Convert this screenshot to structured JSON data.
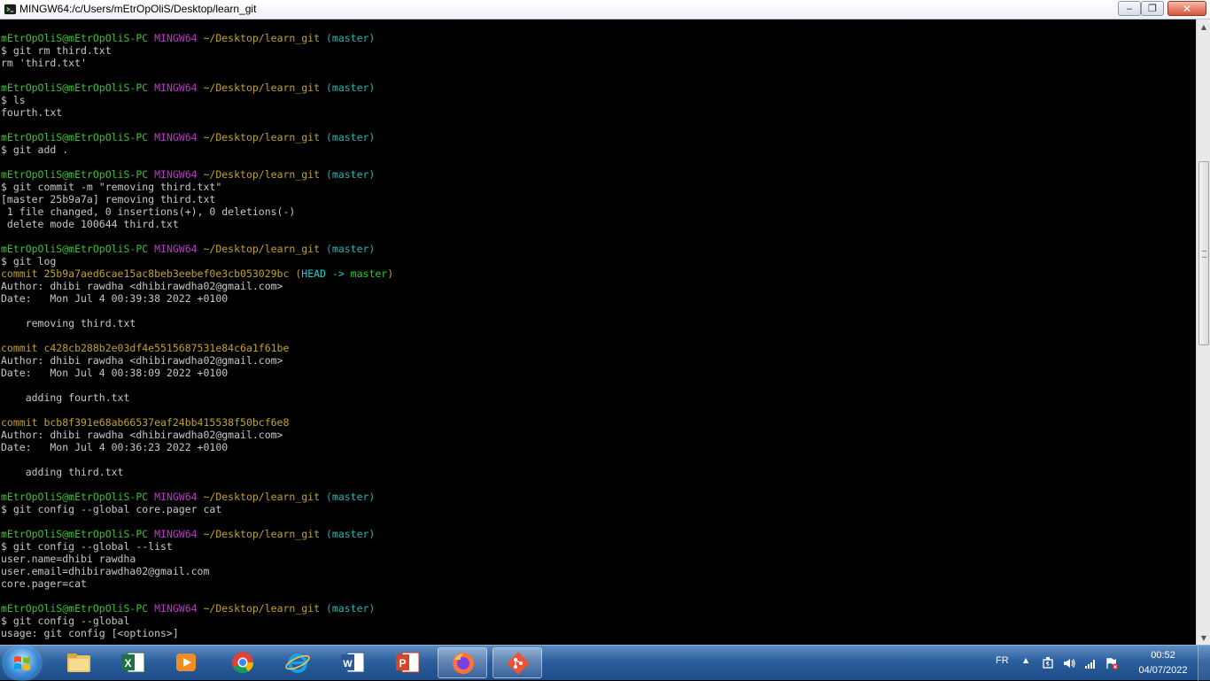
{
  "window": {
    "title": "MINGW64:/c/Users/mEtrOpOliS/Desktop/learn_git",
    "icon": "mingw-icon",
    "controls": {
      "minimize": "minimize-icon",
      "maximize": "maximize-icon",
      "close": "close-icon"
    }
  },
  "terminal": {
    "colors": {
      "prompt_user": "#3fbe37",
      "prompt_shell": "#b63cc0",
      "prompt_path": "#c3a226",
      "prompt_branch": "#2fb1b1",
      "text": "#c7c7c7",
      "background": "#000000"
    },
    "lines": [
      [
        {
          "t": "mEtrOpOliS@mEtrOpOliS-PC ",
          "c": "green"
        },
        {
          "t": "MINGW64 ",
          "c": "magenta"
        },
        {
          "t": "~/Desktop/learn_git ",
          "c": "yellow"
        },
        {
          "t": "(master)",
          "c": "cyan"
        }
      ],
      [
        {
          "t": "$ git rm third.txt",
          "c": "white"
        }
      ],
      [
        {
          "t": "rm 'third.txt'",
          "c": "white"
        }
      ],
      [],
      [
        {
          "t": "mEtrOpOliS@mEtrOpOliS-PC ",
          "c": "green"
        },
        {
          "t": "MINGW64 ",
          "c": "magenta"
        },
        {
          "t": "~/Desktop/learn_git ",
          "c": "yellow"
        },
        {
          "t": "(master)",
          "c": "cyan"
        }
      ],
      [
        {
          "t": "$ ls",
          "c": "white"
        }
      ],
      [
        {
          "t": "fourth.txt",
          "c": "white"
        }
      ],
      [],
      [
        {
          "t": "mEtrOpOliS@mEtrOpOliS-PC ",
          "c": "green"
        },
        {
          "t": "MINGW64 ",
          "c": "magenta"
        },
        {
          "t": "~/Desktop/learn_git ",
          "c": "yellow"
        },
        {
          "t": "(master)",
          "c": "cyan"
        }
      ],
      [
        {
          "t": "$ git add .",
          "c": "white"
        }
      ],
      [],
      [
        {
          "t": "mEtrOpOliS@mEtrOpOliS-PC ",
          "c": "green"
        },
        {
          "t": "MINGW64 ",
          "c": "magenta"
        },
        {
          "t": "~/Desktop/learn_git ",
          "c": "yellow"
        },
        {
          "t": "(master)",
          "c": "cyan"
        }
      ],
      [
        {
          "t": "$ git commit -m \"removing third.txt\"",
          "c": "white"
        }
      ],
      [
        {
          "t": "[master 25b9a7a] removing third.txt",
          "c": "white"
        }
      ],
      [
        {
          "t": " 1 file changed, 0 insertions(+), 0 deletions(-)",
          "c": "white"
        }
      ],
      [
        {
          "t": " delete mode 100644 third.txt",
          "c": "white"
        }
      ],
      [],
      [
        {
          "t": "mEtrOpOliS@mEtrOpOliS-PC ",
          "c": "green"
        },
        {
          "t": "MINGW64 ",
          "c": "magenta"
        },
        {
          "t": "~/Desktop/learn_git ",
          "c": "yellow"
        },
        {
          "t": "(master)",
          "c": "cyan"
        }
      ],
      [
        {
          "t": "$ git log",
          "c": "white"
        }
      ],
      [
        {
          "t": "commit 25b9a7aed6cae15ac8beb3eebef0e3cb053029bc ",
          "c": "yellow"
        },
        {
          "t": "(",
          "c": "yellow"
        },
        {
          "t": "HEAD -> ",
          "c": "cyan-b"
        },
        {
          "t": "master",
          "c": "green-b"
        },
        {
          "t": ")",
          "c": "yellow"
        }
      ],
      [
        {
          "t": "Author: dhibi rawdha <dhibirawdha02@gmail.com>",
          "c": "white"
        }
      ],
      [
        {
          "t": "Date:   Mon Jul 4 00:39:38 2022 +0100",
          "c": "white"
        }
      ],
      [],
      [
        {
          "t": "    removing third.txt",
          "c": "white"
        }
      ],
      [],
      [
        {
          "t": "commit c428cb288b2e03df4e5515687531e84c6a1f61be",
          "c": "yellow"
        }
      ],
      [
        {
          "t": "Author: dhibi rawdha <dhibirawdha02@gmail.com>",
          "c": "white"
        }
      ],
      [
        {
          "t": "Date:   Mon Jul 4 00:38:09 2022 +0100",
          "c": "white"
        }
      ],
      [],
      [
        {
          "t": "    adding fourth.txt",
          "c": "white"
        }
      ],
      [],
      [
        {
          "t": "commit bcb8f391e68ab66537eaf24bb415538f50bcf6e8",
          "c": "yellow"
        }
      ],
      [
        {
          "t": "Author: dhibi rawdha <dhibirawdha02@gmail.com>",
          "c": "white"
        }
      ],
      [
        {
          "t": "Date:   Mon Jul 4 00:36:23 2022 +0100",
          "c": "white"
        }
      ],
      [],
      [
        {
          "t": "    adding third.txt",
          "c": "white"
        }
      ],
      [],
      [
        {
          "t": "mEtrOpOliS@mEtrOpOliS-PC ",
          "c": "green"
        },
        {
          "t": "MINGW64 ",
          "c": "magenta"
        },
        {
          "t": "~/Desktop/learn_git ",
          "c": "yellow"
        },
        {
          "t": "(master)",
          "c": "cyan"
        }
      ],
      [
        {
          "t": "$ git config --global core.pager cat",
          "c": "white"
        }
      ],
      [],
      [
        {
          "t": "mEtrOpOliS@mEtrOpOliS-PC ",
          "c": "green"
        },
        {
          "t": "MINGW64 ",
          "c": "magenta"
        },
        {
          "t": "~/Desktop/learn_git ",
          "c": "yellow"
        },
        {
          "t": "(master)",
          "c": "cyan"
        }
      ],
      [
        {
          "t": "$ git config --global --list",
          "c": "white"
        }
      ],
      [
        {
          "t": "user.name=dhibi rawdha",
          "c": "white"
        }
      ],
      [
        {
          "t": "user.email=dhibirawdha02@gmail.com",
          "c": "white"
        }
      ],
      [
        {
          "t": "core.pager=cat",
          "c": "white"
        }
      ],
      [],
      [
        {
          "t": "mEtrOpOliS@mEtrOpOliS-PC ",
          "c": "green"
        },
        {
          "t": "MINGW64 ",
          "c": "magenta"
        },
        {
          "t": "~/Desktop/learn_git ",
          "c": "yellow"
        },
        {
          "t": "(master)",
          "c": "cyan"
        }
      ],
      [
        {
          "t": "$ git config --global",
          "c": "white"
        }
      ],
      [
        {
          "t": "usage: git config [<options>]",
          "c": "white"
        }
      ]
    ]
  },
  "scrollbar": {
    "position_fraction": 0.31
  },
  "taskbar": {
    "start_icon": "windows-start-icon",
    "items": [
      {
        "name": "file-explorer-icon",
        "active": false
      },
      {
        "name": "excel-icon",
        "active": false
      },
      {
        "name": "media-player-icon",
        "active": false
      },
      {
        "name": "chrome-icon",
        "active": false
      },
      {
        "name": "internet-explorer-icon",
        "active": false
      },
      {
        "name": "word-icon",
        "active": false
      },
      {
        "name": "powerpoint-icon",
        "active": false
      },
      {
        "name": "firefox-icon",
        "active": true
      },
      {
        "name": "git-icon",
        "active": true
      }
    ],
    "tray": {
      "language": "FR",
      "icons": [
        "show-hidden-icons-arrow",
        "power-icon",
        "volume-icon",
        "network-signal-icon",
        "action-center-flag-icon"
      ],
      "time": "00:52",
      "date": "04/07/2022"
    }
  }
}
